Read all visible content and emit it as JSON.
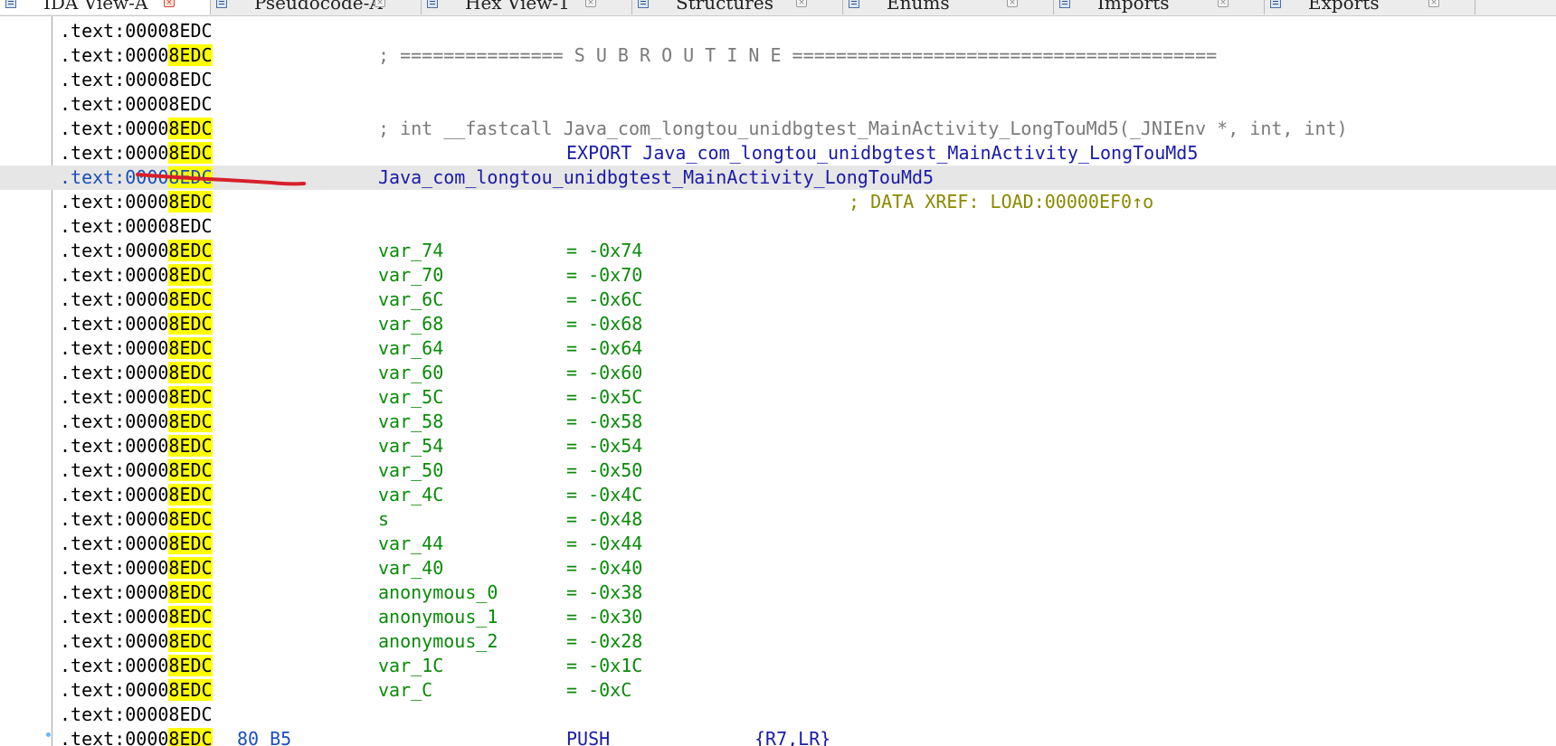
{
  "tabs": [
    {
      "id": "ida-view",
      "label": "IDA View-A",
      "active": true
    },
    {
      "id": "pseudocode",
      "label": "Pseudocode-A",
      "active": false
    },
    {
      "id": "hex-view",
      "label": "Hex View-1",
      "active": false
    },
    {
      "id": "structures",
      "label": "Structures",
      "active": false
    },
    {
      "id": "enums",
      "label": "Enums",
      "active": false
    },
    {
      "id": "imports",
      "label": "Imports",
      "active": false
    },
    {
      "id": "exports",
      "label": "Exports",
      "active": false
    }
  ],
  "listing": {
    "segment": ".text:0000",
    "offset": "8EDC",
    "highlight_color": "#ffff00",
    "rows": [
      {
        "kind": "blank",
        "marked": false
      },
      {
        "kind": "comment",
        "marked": true,
        "text": "; =============== S U B R O U T I N E ======================================="
      },
      {
        "kind": "blank",
        "marked": false
      },
      {
        "kind": "blank",
        "marked": false
      },
      {
        "kind": "comment",
        "marked": true,
        "text": "; int __fastcall Java_com_longtou_unidbgtest_MainActivity_LongTouMd5(_JNIEnv *, int, int)"
      },
      {
        "kind": "export",
        "marked": true,
        "text": "EXPORT Java_com_longtou_unidbgtest_MainActivity_LongTouMd5"
      },
      {
        "kind": "label",
        "marked": true,
        "current": true,
        "text": "Java_com_longtou_unidbgtest_MainActivity_LongTouMd5"
      },
      {
        "kind": "xref",
        "marked": true,
        "text": "; DATA XREF: LOAD:00000EF0↑o"
      },
      {
        "kind": "blank",
        "marked": false
      },
      {
        "kind": "var",
        "marked": true,
        "name": "var_74",
        "value": "= -0x74"
      },
      {
        "kind": "var",
        "marked": true,
        "name": "var_70",
        "value": "= -0x70"
      },
      {
        "kind": "var",
        "marked": true,
        "name": "var_6C",
        "value": "= -0x6C"
      },
      {
        "kind": "var",
        "marked": true,
        "name": "var_68",
        "value": "= -0x68"
      },
      {
        "kind": "var",
        "marked": true,
        "name": "var_64",
        "value": "= -0x64"
      },
      {
        "kind": "var",
        "marked": true,
        "name": "var_60",
        "value": "= -0x60"
      },
      {
        "kind": "var",
        "marked": true,
        "name": "var_5C",
        "value": "= -0x5C"
      },
      {
        "kind": "var",
        "marked": true,
        "name": "var_58",
        "value": "= -0x58"
      },
      {
        "kind": "var",
        "marked": true,
        "name": "var_54",
        "value": "= -0x54"
      },
      {
        "kind": "var",
        "marked": true,
        "name": "var_50",
        "value": "= -0x50"
      },
      {
        "kind": "var",
        "marked": true,
        "name": "var_4C",
        "value": "= -0x4C"
      },
      {
        "kind": "var",
        "marked": true,
        "name": "s",
        "value": "= -0x48"
      },
      {
        "kind": "var",
        "marked": true,
        "name": "var_44",
        "value": "= -0x44"
      },
      {
        "kind": "var",
        "marked": true,
        "name": "var_40",
        "value": "= -0x40"
      },
      {
        "kind": "var",
        "marked": true,
        "name": "anonymous_0",
        "value": "= -0x38"
      },
      {
        "kind": "var",
        "marked": true,
        "name": "anonymous_1",
        "value": "= -0x30"
      },
      {
        "kind": "var",
        "marked": true,
        "name": "anonymous_2",
        "value": "= -0x28"
      },
      {
        "kind": "var",
        "marked": true,
        "name": "var_1C",
        "value": "= -0x1C"
      },
      {
        "kind": "var",
        "marked": true,
        "name": "var_C",
        "value": "= -0xC"
      },
      {
        "kind": "blank",
        "marked": false
      },
      {
        "kind": "insn",
        "marked": true,
        "bytes": "80 B5",
        "mnemonic": "PUSH",
        "operands": "{R7,LR}"
      }
    ]
  },
  "annotation": {
    "color": "#d8202a"
  }
}
